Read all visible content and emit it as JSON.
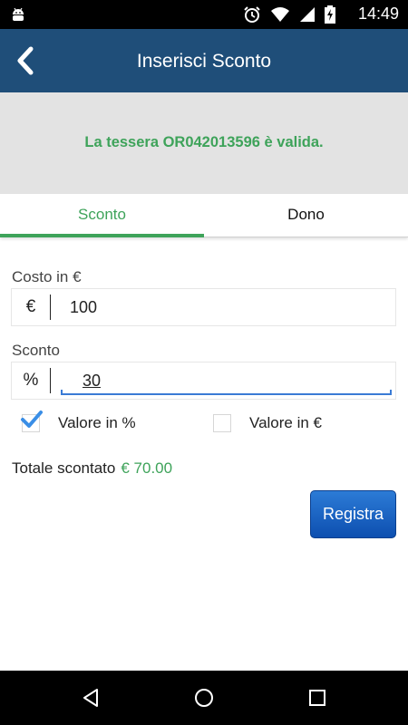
{
  "status_bar": {
    "time": "14:49",
    "icons": [
      "android-debug-icon",
      "alarm-icon",
      "wifi-icon",
      "signal-icon",
      "battery-charging-icon"
    ]
  },
  "app_bar": {
    "title": "Inserisci Sconto",
    "back_icon": "chevron-left-icon",
    "background": "#1f4e79"
  },
  "banner": {
    "message": "La tessera OR042013596 è valida.",
    "color": "#3ea35a"
  },
  "tabs": [
    {
      "label": "Sconto",
      "selected": true
    },
    {
      "label": "Dono",
      "selected": false
    }
  ],
  "form": {
    "cost": {
      "label": "Costo in €",
      "prefix": "€",
      "value": "100"
    },
    "discount": {
      "label": "Sconto",
      "prefix": "%",
      "value": "30"
    },
    "options": [
      {
        "label": "Valore in %",
        "checked": true
      },
      {
        "label": "Valore in €",
        "checked": false
      }
    ],
    "total_label": "Totale scontato",
    "total_value": "€ 70.00",
    "submit_label": "Registra"
  },
  "nav_bar": {
    "icons": [
      "back-triangle-icon",
      "home-circle-icon",
      "recents-square-icon"
    ]
  },
  "colors": {
    "accent_green": "#3ea35a",
    "button_blue": "#1560c4",
    "input_focus": "#3a7bd5"
  }
}
